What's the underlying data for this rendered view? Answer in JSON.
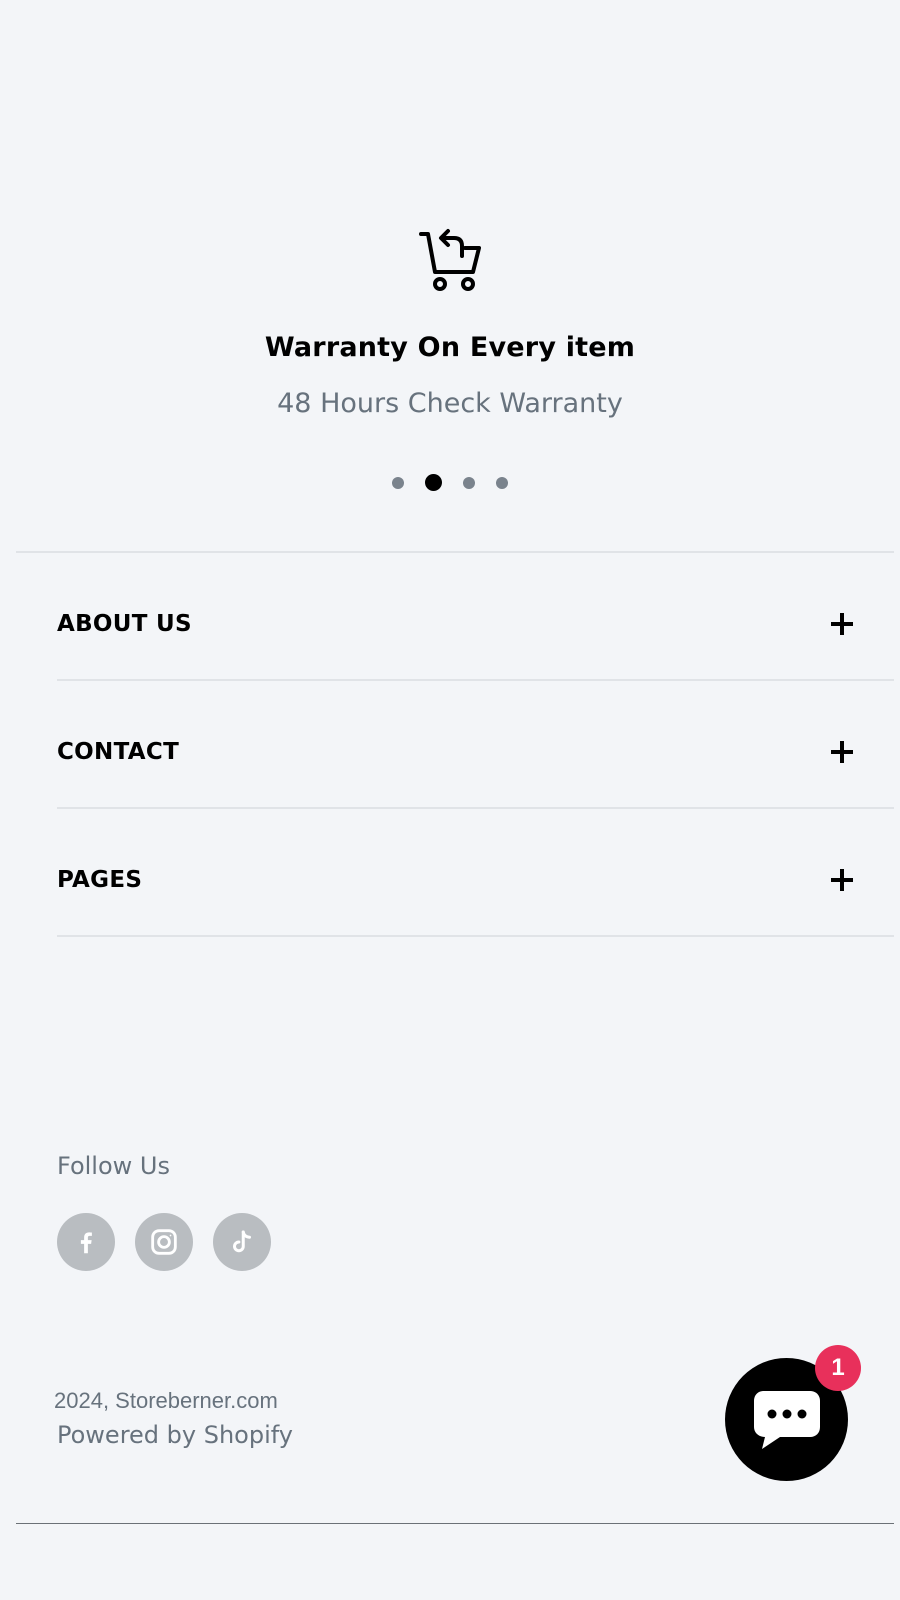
{
  "feature": {
    "icon": "cart-return-icon",
    "title": "Warranty On Every item",
    "subtitle": "48 Hours Check Warranty"
  },
  "carousel": {
    "slides": 4,
    "active_index": 1
  },
  "accordion": {
    "items": [
      {
        "label": "ABOUT US",
        "icon": "plus-icon"
      },
      {
        "label": "CONTACT",
        "icon": "plus-icon"
      },
      {
        "label": "PAGES",
        "icon": "plus-icon"
      }
    ]
  },
  "social": {
    "title": "Follow Us",
    "links": [
      {
        "name": "facebook",
        "icon": "facebook-icon"
      },
      {
        "name": "instagram",
        "icon": "instagram-icon"
      },
      {
        "name": "tiktok",
        "icon": "tiktok-icon"
      }
    ]
  },
  "footer": {
    "copyright": "2024, Storeberner.com",
    "powered": "Powered by Shopify"
  },
  "chat": {
    "icon": "chat-bubble-icon",
    "badge_count": "1",
    "badge_color": "#e8305b"
  }
}
